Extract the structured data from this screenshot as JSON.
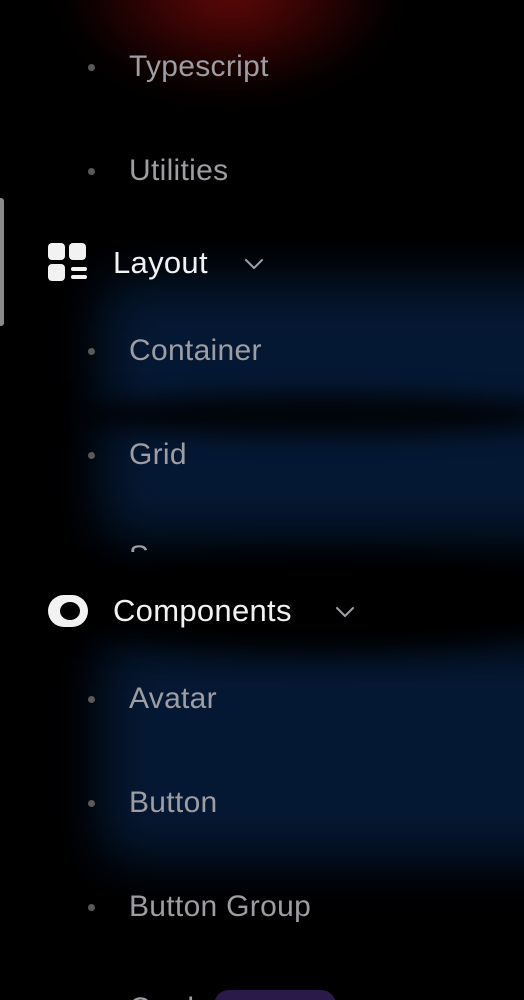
{
  "sidebar": {
    "items_top": [
      {
        "label": "Typescript"
      },
      {
        "label": "Utilities"
      }
    ],
    "layout_section": {
      "label": "Layout",
      "icon": "layout-grid-icon",
      "items": [
        {
          "label": "Container"
        },
        {
          "label": "Grid"
        },
        {
          "label": "S"
        }
      ]
    },
    "components_section": {
      "label": "Components",
      "icon": "toggle-icon",
      "items": [
        {
          "label": "Avatar"
        },
        {
          "label": "Button"
        },
        {
          "label": "Button Group"
        },
        {
          "label": "Card"
        }
      ]
    }
  },
  "colors": {
    "background": "#000000",
    "header_text": "#f2f2f2",
    "item_text": "#9d9da3",
    "bullet": "#5a5a5a",
    "active_indicator": "#8a8a8a"
  }
}
